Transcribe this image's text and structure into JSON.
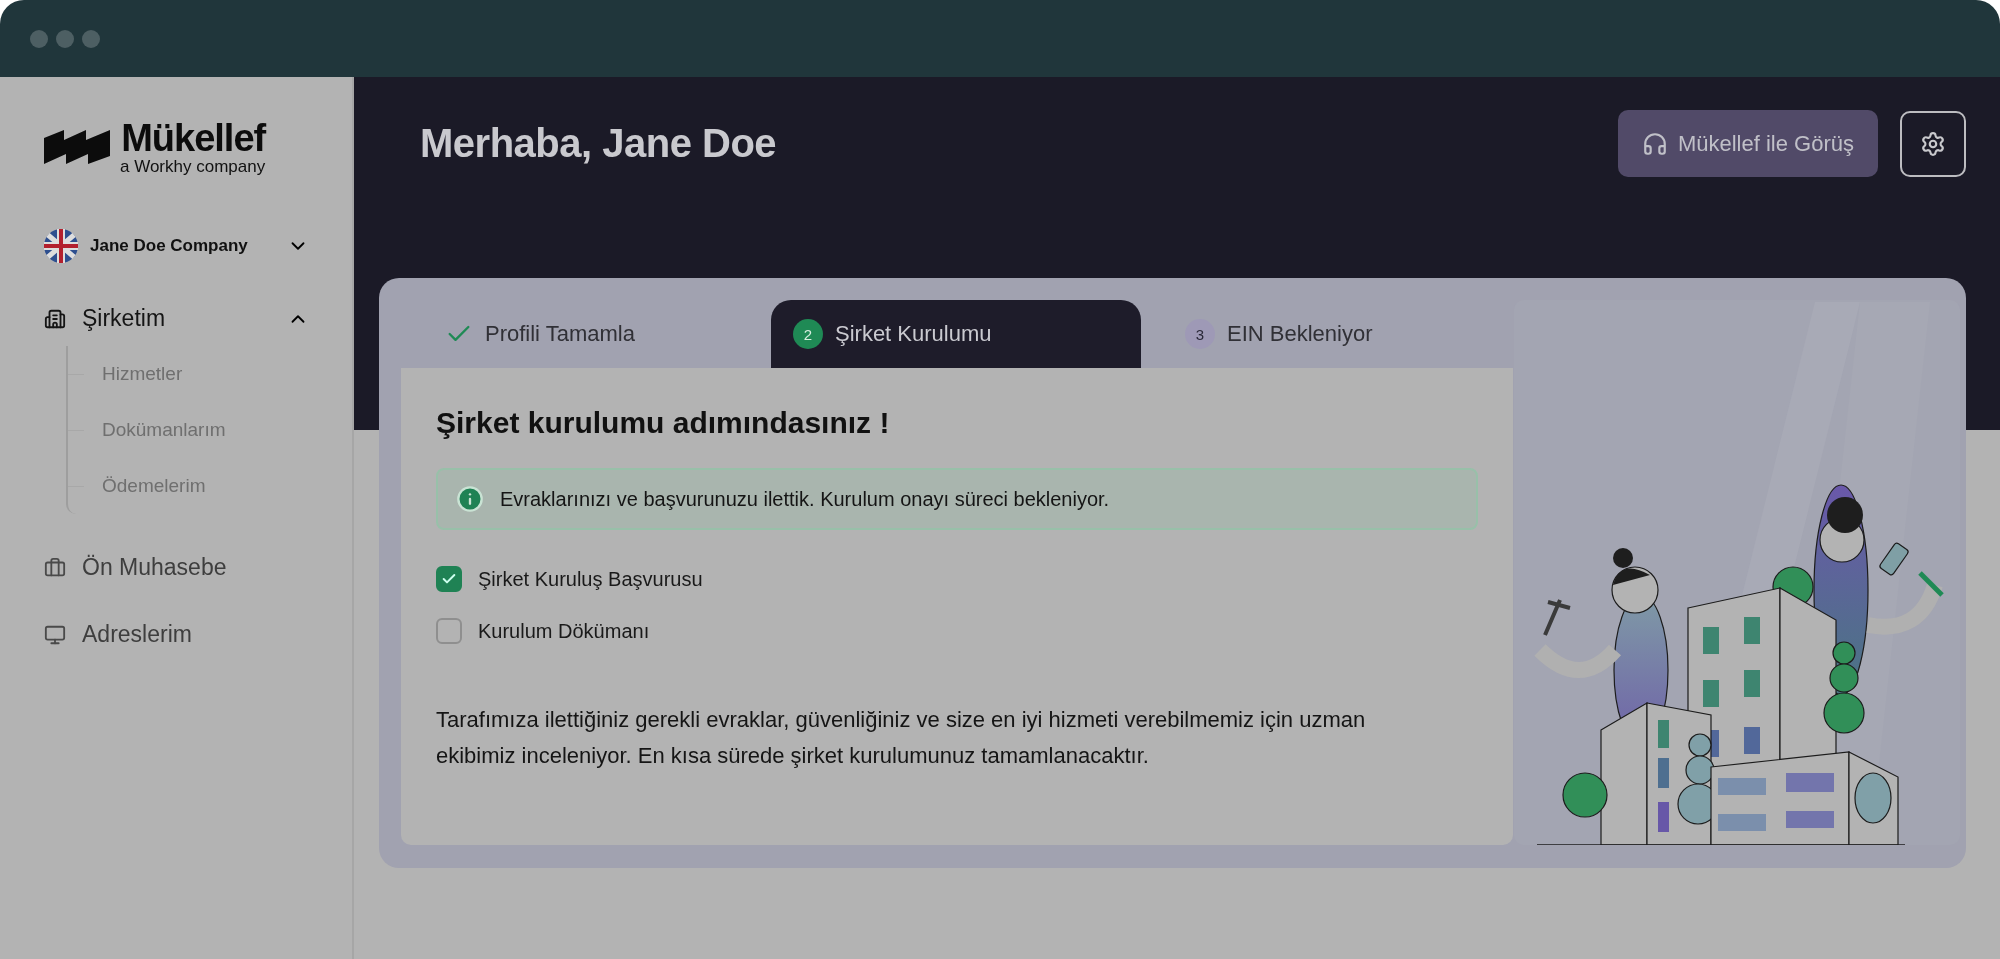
{
  "sidebar": {
    "logo": {
      "name": "Mükellef",
      "tagline": "a Workhy company"
    },
    "company": {
      "name": "Jane Doe Company",
      "expanded": false
    },
    "nav": [
      {
        "label": "Şirketim",
        "expanded": true,
        "children": [
          {
            "label": "Hizmetler"
          },
          {
            "label": "Dokümanlarım"
          },
          {
            "label": "Ödemelerim"
          }
        ]
      },
      {
        "label": "Ön Muhasebe"
      },
      {
        "label": "Adreslerim"
      }
    ]
  },
  "header": {
    "greeting": "Merhaba, Jane Doe",
    "contact_button": "Mükellef ile Görüş"
  },
  "steps": [
    {
      "kind": "done",
      "label": "Profili Tamamla",
      "selected": false
    },
    {
      "kind": "current",
      "number": "2",
      "label": "Şirket Kurulumu",
      "selected": true
    },
    {
      "kind": "pending",
      "number": "3",
      "label": "EIN Bekleniyor",
      "selected": false
    }
  ],
  "content": {
    "heading": "Şirket kurulumu adımındasınız !",
    "notice": "Evraklarınızı ve başvurunuzu ilettik. Kurulum onayı süreci bekleniyor.",
    "checklist": [
      {
        "label": "Şirket Kuruluş Başvurusu",
        "checked": true
      },
      {
        "label": "Kurulum Dökümanı",
        "checked": false
      }
    ],
    "description": "Tarafımıza ilettiğiniz gerekli evraklar, güvenliğiniz ve size en iyi hizmeti verebilmemiz için uzman ekibimiz inceleniyor. En kısa sürede şirket kurulumunuz tamamlanacaktır."
  }
}
